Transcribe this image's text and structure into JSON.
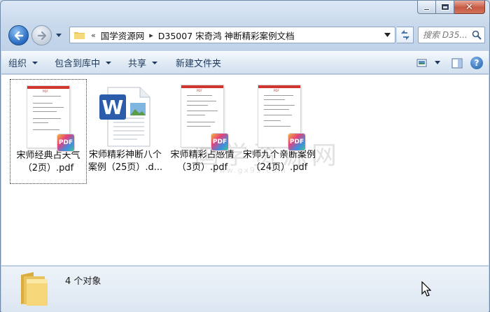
{
  "window": {
    "caption": {
      "min_icon": "minimize-icon",
      "max_icon": "maximize-icon",
      "close_glyph": "✕"
    }
  },
  "nav": {
    "breadcrumb": [
      "«",
      "国学资源网",
      "D35007 宋奇鸿 神断精彩案例文档"
    ],
    "breadcrumb_sep": "▸",
    "search_placeholder": "搜索 D35..."
  },
  "toolbar": {
    "items": [
      {
        "label": "组织",
        "has_menu": true
      },
      {
        "label": "包含到库中",
        "has_menu": true
      },
      {
        "label": "共享",
        "has_menu": true
      },
      {
        "label": "新建文件夹",
        "has_menu": false
      }
    ],
    "help_label": "?"
  },
  "files": [
    {
      "name": "宋师经典占天气（2页）.pdf",
      "type": "pdf",
      "selected": true
    },
    {
      "name": "宋师精彩神断八个案例（25页）.d...",
      "type": "docx",
      "selected": false
    },
    {
      "name": "宋师精彩占感情（3页）.pdf",
      "type": "pdf",
      "selected": false
    },
    {
      "name": "宋师九个亲断案例（24页）.pdf",
      "type": "pdf",
      "selected": false
    }
  ],
  "pdf_badge_label": "PDF",
  "pdf_header_tag": "PDF",
  "word_letter": "W",
  "watermark": {
    "text": "国学资源网",
    "sub": "www.gx95.com"
  },
  "details": {
    "count_text": "4 个对象"
  },
  "colors": {
    "accent": "#2d6fc4",
    "pdf_red": "#d0352f",
    "word_blue": "#2a5caa"
  }
}
